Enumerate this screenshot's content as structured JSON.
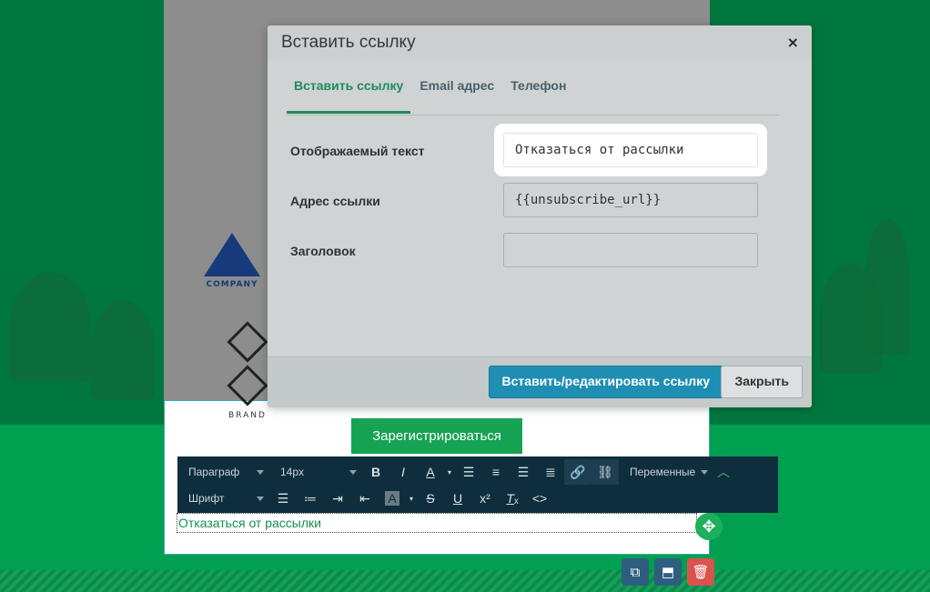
{
  "colors": {
    "brand_green": "#00773f",
    "modal_bg": "#cfd3d4",
    "primary_button": "#1e8fb3",
    "active_tab": "#1f8b5a",
    "toolbar_bg": "#0f2e3d"
  },
  "email": {
    "logo_company": "COMPANY",
    "logo_brand": "BRAND",
    "register_button": "Зарегистрироваться",
    "unsubscribe_text": "Отказаться от рассылки"
  },
  "toolbar": {
    "paragraph_select": "Параграф",
    "size_select": "14px",
    "font_select": "Шрифт",
    "variables_select": "Переменные",
    "icons": [
      "bold-icon",
      "italic-icon",
      "text-color-icon",
      "align-left-icon",
      "align-center-icon",
      "align-right-icon",
      "align-justify-icon",
      "link-icon",
      "unlink-icon",
      "chevron-up-icon",
      "bullet-list-icon",
      "numbered-list-icon",
      "indent-icon",
      "outdent-icon",
      "highlight-icon",
      "strikethrough-icon",
      "underline-icon",
      "superscript-icon",
      "clear-format-icon",
      "code-icon"
    ]
  },
  "block_actions": {
    "icons": [
      "copy-icon",
      "save-icon",
      "trash-icon"
    ]
  },
  "modal": {
    "title": "Вставить ссылку",
    "close": "×",
    "tabs": [
      {
        "label": "Вставить ссылку",
        "active": true
      },
      {
        "label": "Email адрес",
        "active": false
      },
      {
        "label": "Телефон",
        "active": false
      }
    ],
    "fields": {
      "display_text": {
        "label": "Отображаемый текст",
        "value": "Отказаться от рассылки"
      },
      "link_url": {
        "label": "Адрес ссылки",
        "value": "{{unsubscribe_url}}"
      },
      "title": {
        "label": "Заголовок",
        "value": ""
      }
    },
    "primary_button": "Вставить/редактировать ссылку",
    "secondary_button": "Закрыть"
  }
}
